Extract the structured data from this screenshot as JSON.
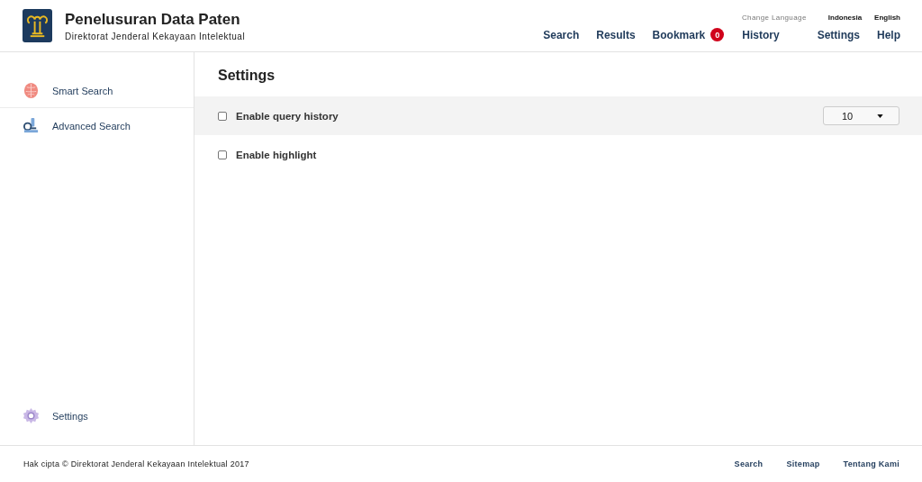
{
  "header": {
    "title": "Penelusuran Data Paten",
    "subtitle": "Direktorat Jenderal Kekayaan Intelektual",
    "nav": [
      {
        "label": "Search"
      },
      {
        "label": "Results"
      },
      {
        "label": "Bookmark",
        "badge": "0"
      },
      {
        "label": "History"
      },
      {
        "label": "Settings"
      },
      {
        "label": "Help"
      }
    ],
    "language": {
      "label": "Change Language",
      "options": [
        "Indonesia",
        "English"
      ]
    }
  },
  "sidebar": {
    "items": [
      {
        "label": "Smart Search",
        "kind": "brain"
      },
      {
        "label": "Advanced Search",
        "kind": "microscope"
      }
    ],
    "bottom_items": [
      {
        "label": "Settings",
        "kind": "gear"
      }
    ]
  },
  "page": {
    "title": "Settings",
    "options": [
      {
        "label": "Enable query history",
        "checked": false,
        "highlighted": true,
        "select": "10"
      },
      {
        "label": "Enable highlight",
        "checked": false,
        "highlighted": false
      }
    ]
  },
  "footer": {
    "copyright": "Hak cipta © Direktorat Jenderal Kekayaan Intelektual 2017",
    "links": [
      "Search",
      "Sitemap",
      "Tentang Kami"
    ]
  }
}
